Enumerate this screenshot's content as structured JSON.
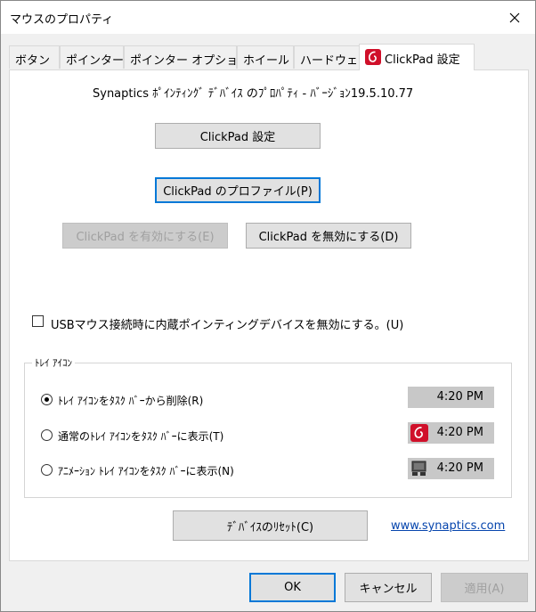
{
  "window": {
    "title": "マウスのプロパティ"
  },
  "tabs": [
    {
      "label": "ボタン"
    },
    {
      "label": "ポインター"
    },
    {
      "label": "ポインター オプション"
    },
    {
      "label": "ホイール"
    },
    {
      "label": "ハードウェア"
    },
    {
      "label": "ClickPad 設定"
    }
  ],
  "panel": {
    "version_text": "Synaptics ﾎﾟｲﾝﾃｨﾝｸﾞ ﾃﾞﾊﾞｲｽ のﾌﾟﾛﾊﾟﾃｨ - ﾊﾞｰｼﾞｮﾝ19.5.10.77",
    "clickpad_settings_button": "ClickPad 設定",
    "profile_button": "ClickPad のプロファイル(P)",
    "enable_button": "ClickPad を有効にする(E)",
    "disable_button": "ClickPad を無効にする(D)",
    "usb_checkbox_label": "USBマウス接続時に内蔵ポインティングデバイスを無効にする。(U)",
    "usb_checkbox_checked": false,
    "tray_group": {
      "legend": "ﾄﾚｲ ｱｲｺﾝ",
      "options": [
        {
          "label": "ﾄﾚｲ ｱｲｺﾝをﾀｽｸ ﾊﾞｰから削除(R)",
          "selected": true,
          "preview_time": "4:20 PM",
          "preview_icon": "none"
        },
        {
          "label": "通常のﾄﾚｲ ｱｲｺﾝをﾀｽｸ ﾊﾞｰに表示(T)",
          "selected": false,
          "preview_time": "4:20 PM",
          "preview_icon": "synaptics-logo-icon"
        },
        {
          "label": "ｱﾆﾒｰｼｮﾝ ﾄﾚｲ ｱｲｺﾝをﾀｽｸ ﾊﾞｰに表示(N)",
          "selected": false,
          "preview_time": "4:20 PM",
          "preview_icon": "touchpad-animated-icon"
        }
      ]
    },
    "reset_button": "ﾃﾞﾊﾞｲｽのﾘｾｯﾄ(C)",
    "website_link": "www.synaptics.com"
  },
  "footer": {
    "ok": "OK",
    "cancel": "キャンセル",
    "apply": "適用(A)"
  },
  "colors": {
    "accent": "#0078d7",
    "synaptics_red": "#d0102a",
    "link": "#0645ad"
  }
}
